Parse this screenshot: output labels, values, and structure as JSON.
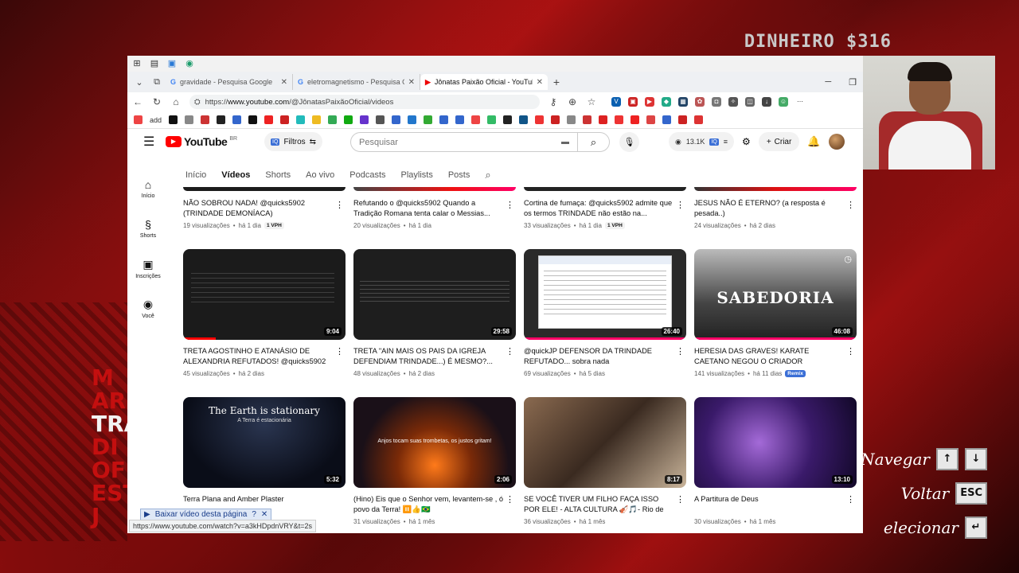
{
  "background": {
    "money_label": "DINHEIRO $316",
    "left_lines": [
      "M",
      "AR",
      "TRA",
      "DI",
      "OF",
      "ESTAT",
      "J"
    ],
    "menu": [
      {
        "label": "Navegar",
        "keys": [
          "↑",
          "↓"
        ]
      },
      {
        "label": "Voltar",
        "keys": [
          "ESC"
        ]
      },
      {
        "label": "elecionar",
        "keys": [
          "↵"
        ]
      }
    ]
  },
  "browser": {
    "tabs": [
      {
        "title": "gravidade - Pesquisa Google",
        "icon": "G"
      },
      {
        "title": "eletromagnetismo - Pesquisa Goo",
        "icon": "G"
      },
      {
        "title": "Jônatas Paixão Oficial - YouTube",
        "icon": "▶",
        "active": true
      }
    ],
    "url_prefix": "https://",
    "url_host": "www.youtube.com",
    "url_path": "/@JônatasPaixãoOficial/videos",
    "bookmark_add": "add",
    "status_url": "https://www.youtube.com/watch?v=a3kHDpdnVRY&t=2s",
    "download_label": "Baixar vídeo desta página"
  },
  "youtube": {
    "logo_text": "YouTube",
    "logo_region": "BR",
    "filters_label": "Filtros",
    "search_placeholder": "Pesquisar",
    "views_count": "13.1K",
    "create_label": "Criar",
    "sidebar": [
      {
        "label": "Início",
        "icon": "⌂"
      },
      {
        "label": "Shorts",
        "icon": "§"
      },
      {
        "label": "Inscrições",
        "icon": "▣"
      },
      {
        "label": "Você",
        "icon": "◉"
      }
    ],
    "channel_tabs": [
      "Início",
      "Vídeos",
      "Shorts",
      "Ao vivo",
      "Podcasts",
      "Playlists",
      "Posts"
    ],
    "videos_row1": [
      {
        "title": "NÃO SOBROU NADA! @quicks5902 (TRINDADE DEMONÍACA)",
        "views": "19 visualizações",
        "age": "há 1 dia",
        "badge": "1 VPH"
      },
      {
        "title": "Refutando o @quicks5902 Quando a Tradição Romana tenta calar o Messias...",
        "views": "20 visualizações",
        "age": "há 1 dia",
        "badge": ""
      },
      {
        "title": "Cortina de fumaça: @quicks5902 admite que os termos TRINDADE não estão na...",
        "views": "33 visualizações",
        "age": "há 1 dia",
        "badge": "1 VPH"
      },
      {
        "title": "JESUS NÃO É ETERNO? (a resposta é pesada..)",
        "views": "24 visualizações",
        "age": "há 2 dias",
        "badge": ""
      }
    ],
    "videos_row2": [
      {
        "title": "TRETA AGOSTINHO E ATANÁSIO DE ALEXANDRIA REFUTADOS! @quicks5902",
        "views": "45 visualizações",
        "age": "há 2 dias",
        "badge": "",
        "duration": "9:04"
      },
      {
        "title": "TRETA \"AIN MAIS OS PAIS DA IGREJA DEFENDIAM TRINDADE...) É MESMO?...",
        "views": "48 visualizações",
        "age": "há 2 dias",
        "badge": "",
        "duration": "29:58"
      },
      {
        "title": "@quickJP DEFENSOR DA TRINDADE REFUTADO... sobra nada",
        "views": "69 visualizações",
        "age": "há 5 dias",
        "badge": "",
        "duration": "26:40"
      },
      {
        "title": "HERESIA DAS GRAVES! KARATE CAETANO NEGOU O CRIADOR NOVAMENTE! (E AIND...",
        "views": "141 visualizações",
        "age": "há 11 dias",
        "badge": "Remix",
        "duration": "46:08",
        "thumb_text": "SABEDORIA"
      }
    ],
    "videos_row3": [
      {
        "title": "Terra Plana and Amber Plaster",
        "views": "",
        "age": "",
        "badge": "",
        "duration": "5:32",
        "thumb_text": "The Earth is stationary",
        "thumb_sub": "A Terra é estacionária"
      },
      {
        "title": "(Hino) Eis que o Senhor vem, levantem-se , ó povo da Terra! ⏸️👍🇧🇷",
        "views": "31 visualizações",
        "age": "há 1 mês",
        "badge": "",
        "duration": "2:06",
        "thumb_text": "Anjos tocam suas trombetas, os justos gritam!"
      },
      {
        "title": "SE VOCÊ TIVER UM FILHO FAÇA ISSO POR ELE! - ALTA CULTURA 🎻🎵- Rio de Janeir...",
        "views": "36 visualizações",
        "age": "há 1 mês",
        "badge": "",
        "duration": "8:17"
      },
      {
        "title": "A Partitura de Deus",
        "views": "30 visualizações",
        "age": "há 1 mês",
        "badge": "",
        "duration": "13:10"
      }
    ]
  }
}
